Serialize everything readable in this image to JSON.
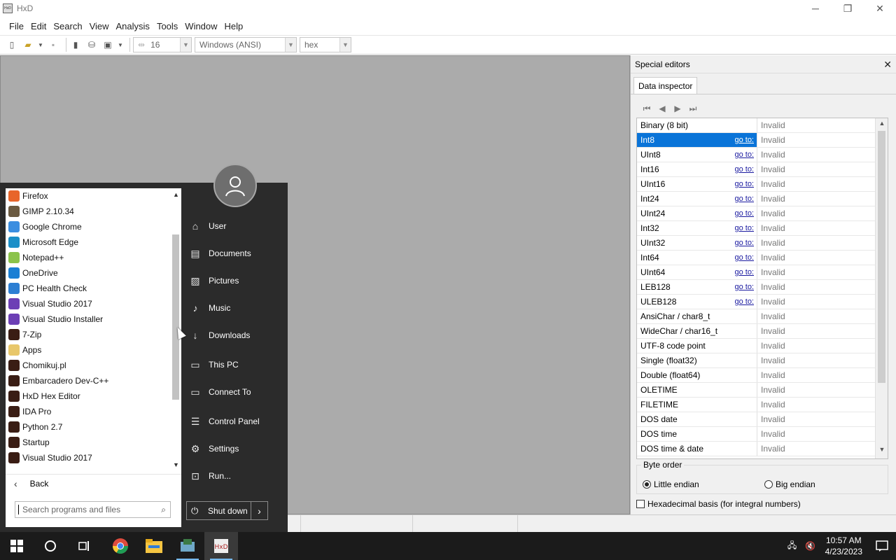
{
  "window": {
    "title": "HxD",
    "app_icon_text": "HxD"
  },
  "menu": [
    "File",
    "Edit",
    "Search",
    "View",
    "Analysis",
    "Tools",
    "Window",
    "Help"
  ],
  "toolbar": {
    "bytes_per_row": "16",
    "charset": "Windows (ANSI)",
    "offset_base": "hex"
  },
  "special_editors": {
    "title": "Special editors",
    "tab": "Data inspector",
    "goto_label": "go to:",
    "rows": [
      {
        "name": "Binary (8 bit)",
        "value": "Invalid",
        "goto": false
      },
      {
        "name": "Int8",
        "value": "Invalid",
        "goto": true,
        "selected": true
      },
      {
        "name": "UInt8",
        "value": "Invalid",
        "goto": true
      },
      {
        "name": "Int16",
        "value": "Invalid",
        "goto": true
      },
      {
        "name": "UInt16",
        "value": "Invalid",
        "goto": true
      },
      {
        "name": "Int24",
        "value": "Invalid",
        "goto": true
      },
      {
        "name": "UInt24",
        "value": "Invalid",
        "goto": true
      },
      {
        "name": "Int32",
        "value": "Invalid",
        "goto": true
      },
      {
        "name": "UInt32",
        "value": "Invalid",
        "goto": true
      },
      {
        "name": "Int64",
        "value": "Invalid",
        "goto": true
      },
      {
        "name": "UInt64",
        "value": "Invalid",
        "goto": true
      },
      {
        "name": "LEB128",
        "value": "Invalid",
        "goto": true
      },
      {
        "name": "ULEB128",
        "value": "Invalid",
        "goto": true
      },
      {
        "name": "AnsiChar / char8_t",
        "value": "Invalid",
        "goto": false
      },
      {
        "name": "WideChar / char16_t",
        "value": "Invalid",
        "goto": false
      },
      {
        "name": "UTF-8 code point",
        "value": "Invalid",
        "goto": false
      },
      {
        "name": "Single (float32)",
        "value": "Invalid",
        "goto": false
      },
      {
        "name": "Double (float64)",
        "value": "Invalid",
        "goto": false
      },
      {
        "name": "OLETIME",
        "value": "Invalid",
        "goto": false
      },
      {
        "name": "FILETIME",
        "value": "Invalid",
        "goto": false
      },
      {
        "name": "DOS date",
        "value": "Invalid",
        "goto": false
      },
      {
        "name": "DOS time",
        "value": "Invalid",
        "goto": false
      },
      {
        "name": "DOS time & date",
        "value": "Invalid",
        "goto": false
      }
    ],
    "byte_order": {
      "legend": "Byte order",
      "little": "Little endian",
      "big": "Big endian",
      "selected": "little"
    },
    "hex_basis": "Hexadecimal basis (for integral numbers)"
  },
  "start_menu": {
    "programs": [
      {
        "name": "Firefox",
        "icon": "firefox-icon",
        "color": "#e8652a"
      },
      {
        "name": "GIMP 2.10.34",
        "icon": "gimp-icon",
        "color": "#6b5a40"
      },
      {
        "name": "Google Chrome",
        "icon": "chrome-icon",
        "color": "#3b8ee0"
      },
      {
        "name": "Microsoft Edge",
        "icon": "edge-icon",
        "color": "#1b8fc8"
      },
      {
        "name": "Notepad++",
        "icon": "notepadpp-icon",
        "color": "#8bc34a"
      },
      {
        "name": "OneDrive",
        "icon": "onedrive-icon",
        "color": "#1a7fd4"
      },
      {
        "name": "PC Health Check",
        "icon": "pc-health-icon",
        "color": "#2d7fd3"
      },
      {
        "name": "Visual Studio 2017",
        "icon": "visual-studio-icon",
        "color": "#6c3fb5"
      },
      {
        "name": "Visual Studio Installer",
        "icon": "vs-installer-icon",
        "color": "#6c3fb5"
      },
      {
        "name": "7-Zip",
        "icon": "folder-icon",
        "color": "#3a1d14"
      },
      {
        "name": "Apps",
        "icon": "apps-folder-icon",
        "color": "#e8c76a"
      },
      {
        "name": "Chomikuj.pl",
        "icon": "folder-icon",
        "color": "#3a1d14"
      },
      {
        "name": "Embarcadero Dev-C++",
        "icon": "folder-icon",
        "color": "#3a1d14"
      },
      {
        "name": "HxD Hex Editor",
        "icon": "folder-icon",
        "color": "#3a1d14"
      },
      {
        "name": "IDA Pro",
        "icon": "folder-icon",
        "color": "#3a1d14"
      },
      {
        "name": "Python 2.7",
        "icon": "folder-icon",
        "color": "#3a1d14"
      },
      {
        "name": "Startup",
        "icon": "folder-icon",
        "color": "#3a1d14"
      },
      {
        "name": "Visual Studio 2017",
        "icon": "folder-icon",
        "color": "#3a1d14"
      }
    ],
    "back": "Back",
    "search_placeholder": "Search programs and files",
    "places": [
      {
        "label": "User",
        "icon": "user-folder-icon",
        "glyph": "⌂"
      },
      {
        "label": "Documents",
        "icon": "documents-icon",
        "glyph": "▤"
      },
      {
        "label": "Pictures",
        "icon": "pictures-icon",
        "glyph": "▨"
      },
      {
        "label": "Music",
        "icon": "music-icon",
        "glyph": "♪"
      },
      {
        "label": "Downloads",
        "icon": "downloads-icon",
        "glyph": "↓"
      },
      {
        "label": "This PC",
        "icon": "computer-icon",
        "glyph": "▭"
      },
      {
        "label": "Connect To",
        "icon": "connect-icon",
        "glyph": "▭"
      },
      {
        "label": "Control Panel",
        "icon": "control-panel-icon",
        "glyph": "☰"
      },
      {
        "label": "Settings",
        "icon": "settings-icon",
        "glyph": "⚙"
      },
      {
        "label": "Run...",
        "icon": "run-icon",
        "glyph": "⊡"
      }
    ],
    "shutdown": "Shut down"
  },
  "taskbar": {
    "time": "10:57 AM",
    "date": "4/23/2023"
  }
}
